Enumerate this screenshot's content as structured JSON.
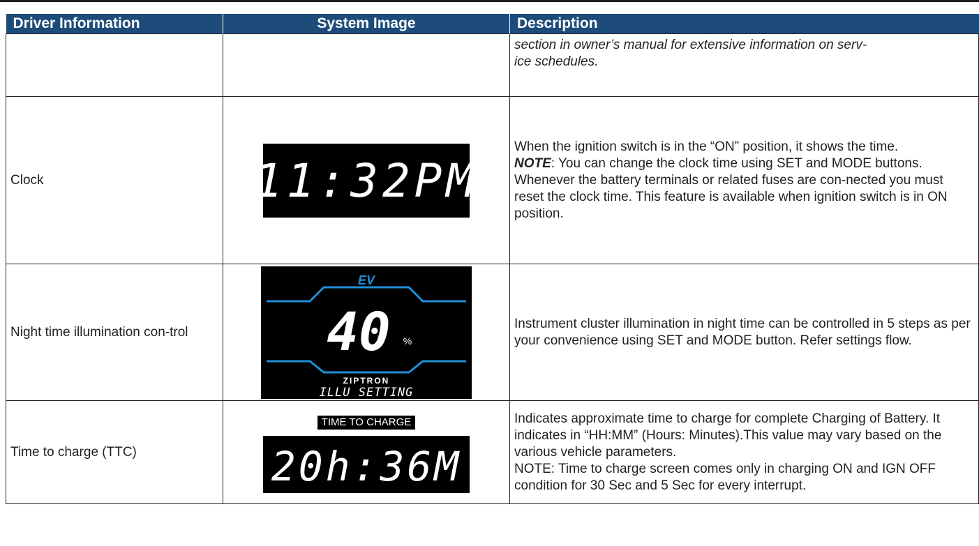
{
  "header": {
    "col1": "Driver Information",
    "col2": "System Image",
    "col3": "Description"
  },
  "rows": [
    {
      "name": "",
      "description_lines": [
        "section in owner’s manual for extensive information on serv-",
        "ice schedules."
      ]
    },
    {
      "name": "Clock",
      "display_text": "11:32PM",
      "description_parts": [
        "When the ignition switch is in the “ON” position, it shows the time.",
        "NOTE",
        ": You can change the clock time using SET and MODE buttons.",
        "Whenever the battery terminals or related fuses are con-nected you must reset the clock time. This feature is available when ignition switch is in ON position."
      ]
    },
    {
      "name": "Night time illumination con-trol",
      "display": {
        "badge": "EV",
        "value": "40",
        "unit": "%",
        "brand": "ZIPTRON",
        "caption": "ILLU SETTING"
      },
      "description": "Instrument cluster illumination in night time can be controlled in 5 steps as per your convenience using SET and MODE button. Refer settings flow."
    },
    {
      "name": "Time to charge (TTC)",
      "display_label": "TIME TO CHARGE",
      "display_text": "20h:36M",
      "description_parts": [
        "Indicates approximate time to charge for complete Charging of Battery. It indicates in “HH:MM” (Hours: Minutes).This value may vary based on the various vehicle parameters.",
        "NOTE: Time to charge screen comes only in charging ON and IGN OFF condition for 30 Sec and 5 Sec for every interrupt."
      ]
    }
  ],
  "colors": {
    "header_bg": "#1e4c7a",
    "accent_blue": "#1e90d6",
    "lcd_bg": "#000000"
  }
}
